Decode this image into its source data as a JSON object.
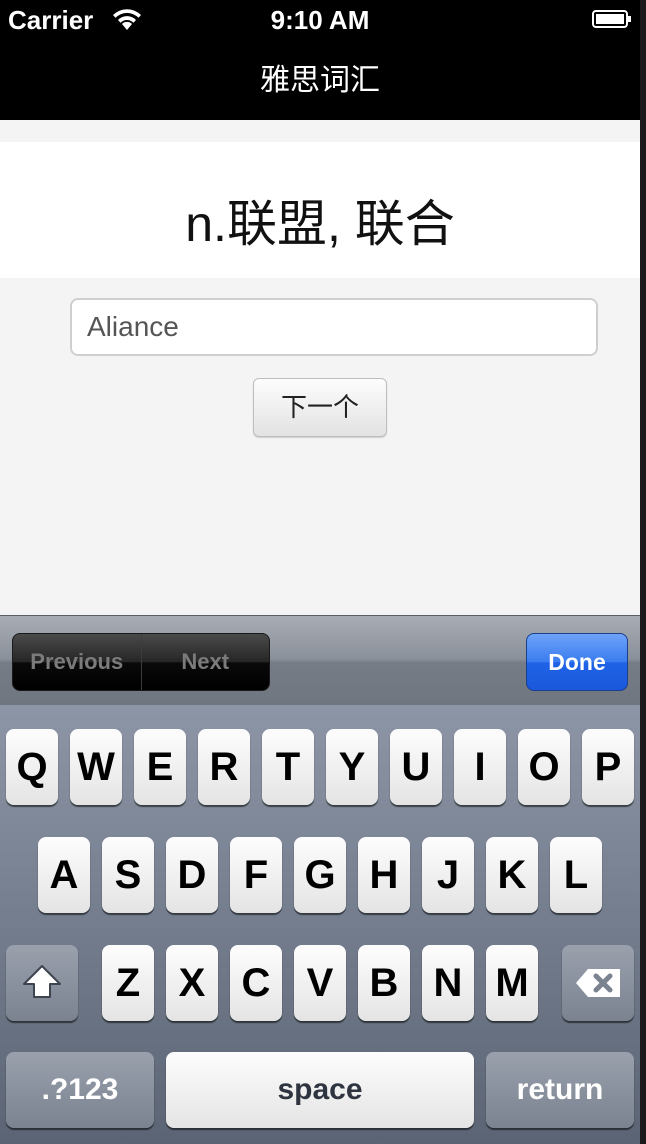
{
  "status_bar": {
    "carrier": "Carrier",
    "time": "9:10 AM",
    "wifi_icon": "wifi-icon",
    "battery_icon": "battery-icon"
  },
  "nav": {
    "title": "雅思词汇"
  },
  "quiz": {
    "definition": "n.联盟, 联合",
    "answer_value": "Aliance",
    "next_label": "下一个"
  },
  "accessory_bar": {
    "previous_label": "Previous",
    "next_label": "Next",
    "done_label": "Done"
  },
  "keyboard": {
    "row1": [
      "Q",
      "W",
      "E",
      "R",
      "T",
      "Y",
      "U",
      "I",
      "O",
      "P"
    ],
    "row2": [
      "A",
      "S",
      "D",
      "F",
      "G",
      "H",
      "J",
      "K",
      "L"
    ],
    "row3": [
      "Z",
      "X",
      "C",
      "V",
      "B",
      "N",
      "M"
    ],
    "shift_icon": "shift-icon",
    "delete_icon": "backspace-icon",
    "numbers_label": ".?123",
    "space_label": "space",
    "return_label": "return"
  },
  "colors": {
    "nav_background": "#000000",
    "done_button": "#1f63e6",
    "keyboard_background": "#6e7788"
  }
}
